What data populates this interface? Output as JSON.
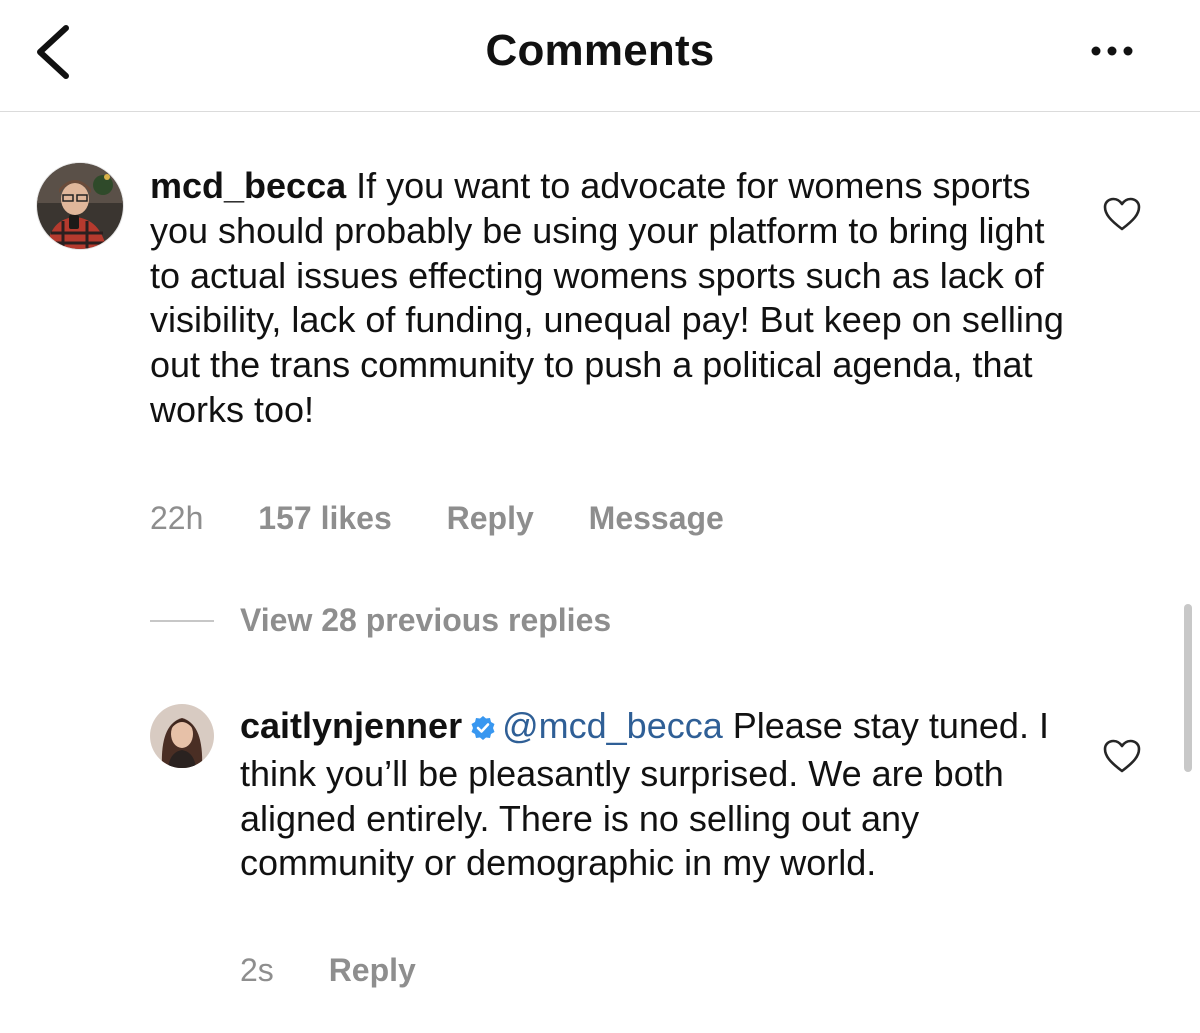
{
  "header": {
    "title": "Comments"
  },
  "comments": [
    {
      "username": "mcd_becca",
      "text": "If you want to advocate for womens sports you should probably be using your platform to bring light to actual issues effecting womens sports such as lack of visibility, lack of funding, unequal pay! But keep on selling out the trans community to push a political agenda, that works too!",
      "time": "22h",
      "likes": "157 likes",
      "reply_label": "Reply",
      "message_label": "Message"
    }
  ],
  "view_replies": "View 28 previous replies",
  "replies": [
    {
      "username": "caitlynjenner",
      "verified": true,
      "mention": "@mcd_becca",
      "text": "Please stay tuned. I think you’ll be pleasantly surprised. We are both aligned entirely. There is no selling out any community or demographic in my world.",
      "time": "2s",
      "reply_label": "Reply"
    }
  ],
  "icons": {
    "back": "chevron-left-icon",
    "more": "more-horizontal-icon",
    "like": "heart-outline-icon",
    "verified": "verified-badge-icon"
  },
  "colors": {
    "text": "#111111",
    "secondary": "#8e8e8e",
    "mention": "#2f5f96",
    "verified": "#3897f0",
    "divider": "#dbdbdb"
  }
}
